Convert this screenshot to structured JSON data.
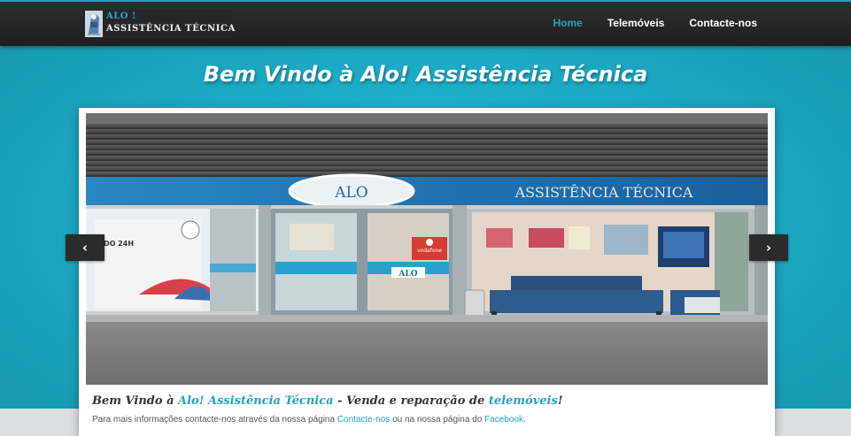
{
  "header": {
    "logo_line1": "ALO !",
    "logo_line2": "ASSISTÊNCIA TÉCNICA",
    "nav": [
      {
        "label": "Home",
        "active": true
      },
      {
        "label": "Telemóveis",
        "active": false
      },
      {
        "label": "Contacte-nos",
        "active": false
      }
    ]
  },
  "hero": {
    "title": "Bem Vindo à Alo! Assistência Técnica"
  },
  "slider": {
    "prev_icon": "chevron-left-icon",
    "next_icon": "chevron-right-icon",
    "prev_label": "‹",
    "next_label": "›",
    "photo_signage": {
      "alo": "ALO",
      "assistencia": "ASSISTÊNCIA TÉCNICA",
      "window_text": "DO 24H",
      "vodafone": "vodafone",
      "door_logo": "ALO"
    }
  },
  "caption": {
    "part1": "Bem Vindo à ",
    "highlight1": "Alo! Assistência Técnica",
    "part2": " - Venda e reparação de ",
    "highlight2": "telemóveis",
    "part3": "!",
    "sub_part1": "Para mais informações contacte-nos através da nossa página ",
    "sub_link1": "Contacte-nos",
    "sub_part2": " ou na nossa página do ",
    "sub_link2": "Facebook",
    "sub_part3": "."
  },
  "colors": {
    "accent": "#1fa3c7",
    "background": "#1ea9c4",
    "header": "#262626"
  }
}
